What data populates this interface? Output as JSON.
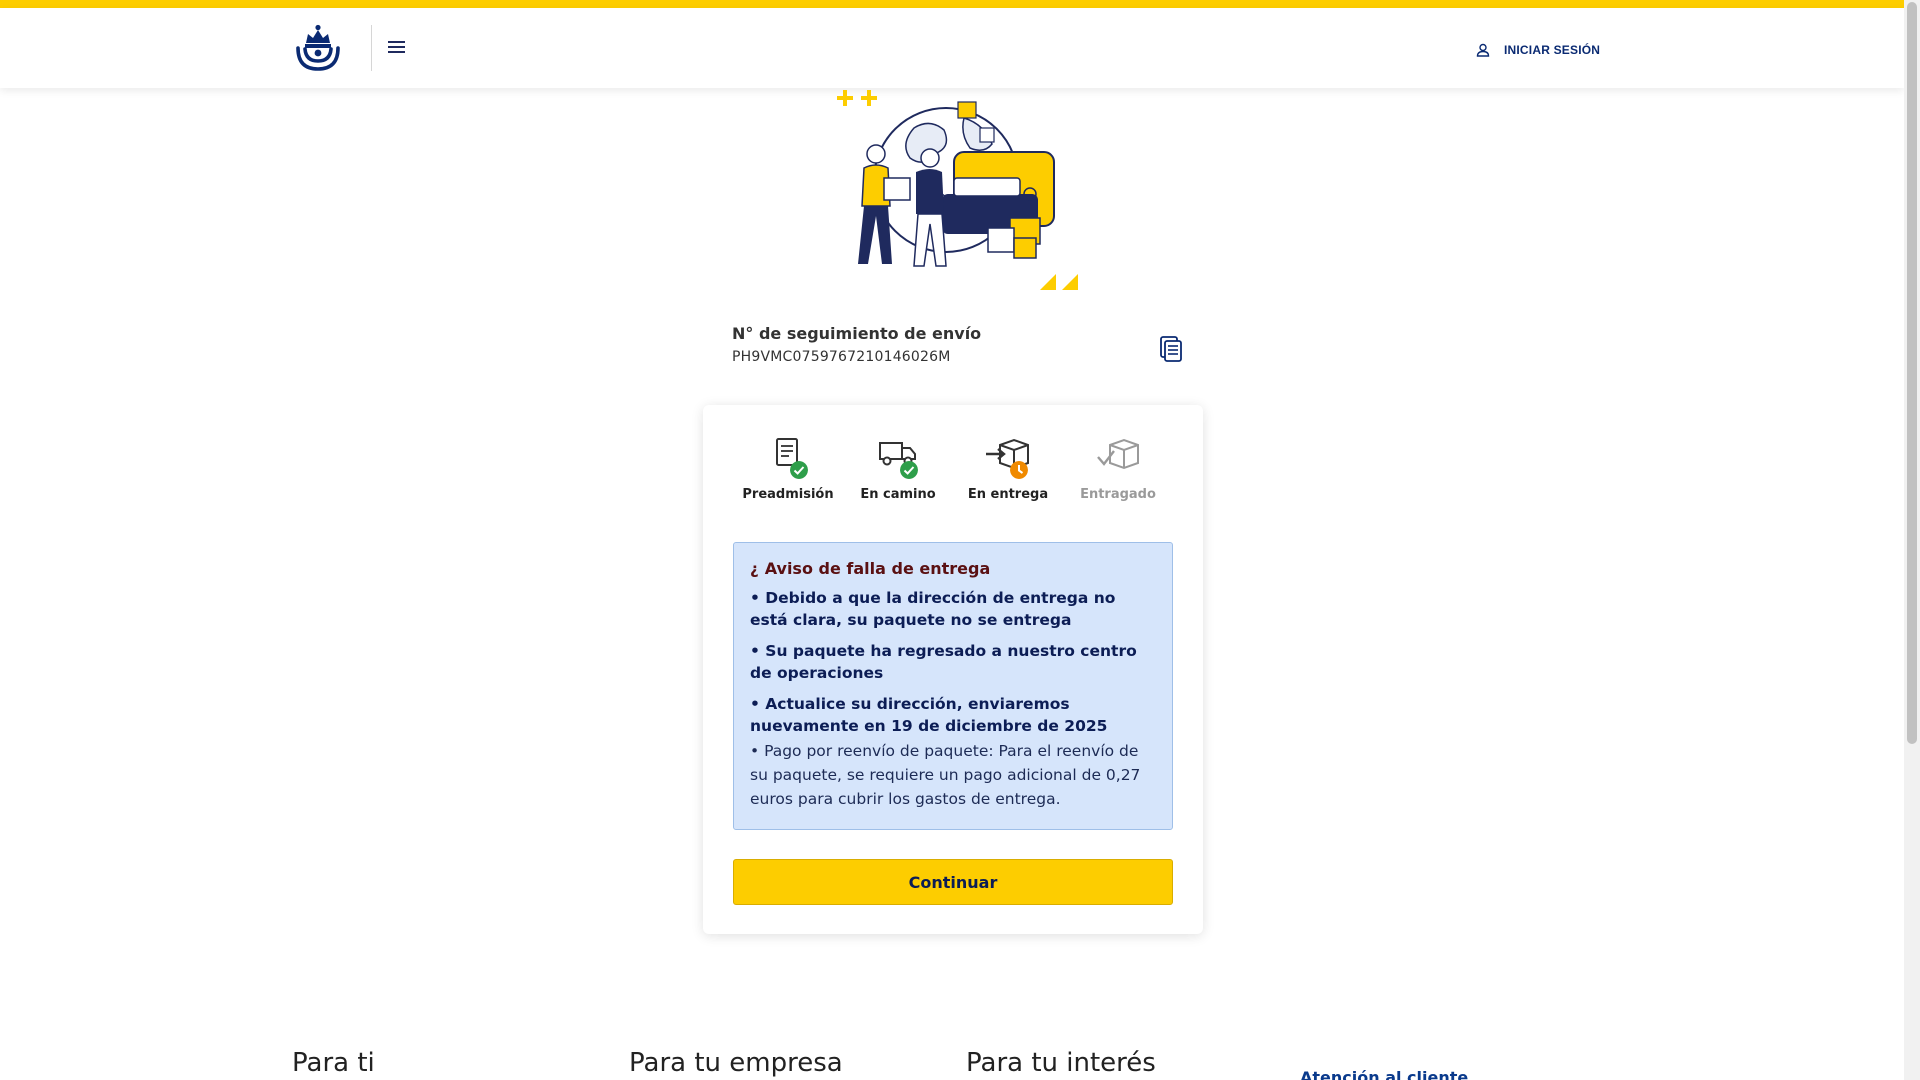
{
  "header": {
    "login_label": "INICIAR SESIÓN",
    "logo_icon": "correos-horn-crown-logo",
    "menu_icon": "hamburger-menu-icon"
  },
  "tracking": {
    "label": "N° de seguimiento de envío",
    "number": "PH9VMC0759767210146026M"
  },
  "steps": [
    {
      "label": "Preadmisión",
      "status": "done"
    },
    {
      "label": "En camino",
      "status": "done"
    },
    {
      "label": "En entrega",
      "status": "pending"
    },
    {
      "label": "Entragado",
      "status": "inactive"
    }
  ],
  "notice": {
    "hook": "¿",
    "title": "Aviso de falla de entrega",
    "bullets": [
      "• Debido a que la dirección de entrega no está clara, su paquete no se entrega",
      "• Su paquete ha regresado a nuestro centro de operaciones",
      "• Actualice su dirección, enviaremos nuevamente en 19 de diciembre de 2025"
    ],
    "payment": "• Pago por reenvío de paquete: Para el reenvío de su paquete, se requiere un pago adicional de 0,27 euros para cubrir los gastos de entrega."
  },
  "continue_label": "Continuar",
  "footer": {
    "col1": "Para ti",
    "col2": "Para tu empresa",
    "col3": "Para tu interés",
    "col4": "Atención al cliente"
  },
  "colors": {
    "brand_yellow": "#fdcd00",
    "brand_blue": "#0a2a72",
    "check_green": "#2e9e4a",
    "clock_orange": "#f08a00"
  }
}
